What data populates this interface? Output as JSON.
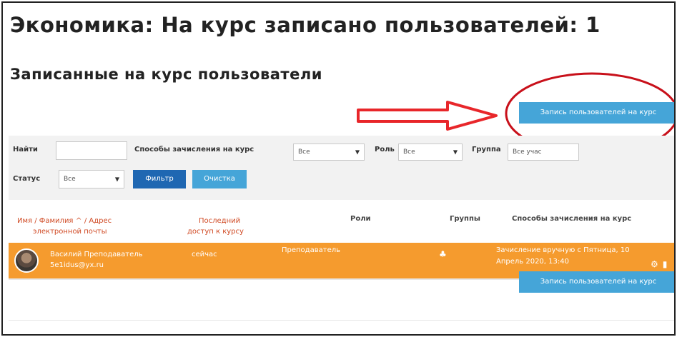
{
  "page": {
    "title": "Экономика: На курс записано пользователей: 1",
    "section_title": "Записанные на курс пользователи"
  },
  "actions": {
    "enrol_button_label": "Запись пользователей на курс"
  },
  "filters": {
    "search_label": "Найти",
    "search_value": "",
    "enrol_methods_label": "Способы зачисления на курс",
    "enrol_methods_value": "Все",
    "role_label": "Роль",
    "role_value": "Все",
    "group_label": "Группа",
    "group_value": "Все учас",
    "status_label": "Статус",
    "status_value": "Все",
    "filter_button": "Фильтр",
    "clear_button": "Очистка"
  },
  "table": {
    "headers": {
      "name_part1": "Имя / Фамилия",
      "name_sort_mark": "^",
      "name_part2": "/ Адрес",
      "name_part3": "электронной почты",
      "last_access_line1": "Последний",
      "last_access_line2": "доступ к курсу",
      "roles": "Роли",
      "groups": "Группы",
      "enrol_methods": "Способы зачисления на курс"
    },
    "rows": [
      {
        "name": "Василий Преподаватель",
        "email": "5e1idus@yx.ru",
        "last_access": "сейчас",
        "role": "Преподаватель",
        "enrol_method_line1": "Зачисление вручную с Пятница, 10",
        "enrol_method_line2": "Апрель 2020, 13:40"
      }
    ]
  },
  "annotations": {
    "arrow_color": "#e8262a",
    "ellipse_color": "#c8101a"
  },
  "colors": {
    "accent_blue": "#45a5d8",
    "primary_blue": "#1f67b2",
    "row_highlight": "#f59b2e"
  }
}
